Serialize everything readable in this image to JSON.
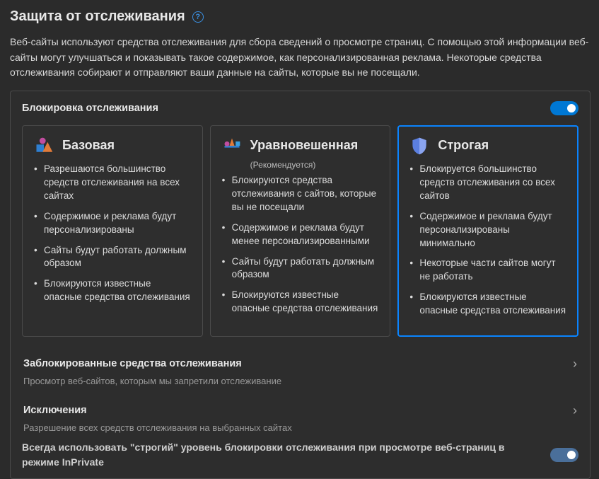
{
  "heading": "Защита от отслеживания",
  "intro": "Веб-сайты используют средства отслеживания для сбора сведений о просмотре страниц. С помощью этой информации веб-сайты могут улучшаться и показывать такое содержимое, как персонализированная реклама. Некоторые средства отслеживания собирают и отправляют ваши данные на сайты, которые вы не посещали.",
  "panel_title": "Блокировка отслеживания",
  "tracking_toggle_on": true,
  "selected_level": "strict",
  "cards": {
    "basic": {
      "title": "Базовая",
      "items": [
        "Разрешаются большинство средств отслеживания на всех сайтах",
        "Содержимое и реклама будут персонализированы",
        "Сайты будут работать должным образом",
        "Блокируются известные опасные средства отслеживания"
      ]
    },
    "balanced": {
      "title": "Уравновешенная",
      "recommended": "(Рекомендуется)",
      "items": [
        "Блокируются средства отслеживания с сайтов, которые вы не посещали",
        "Содержимое и реклама будут менее персонализированными",
        "Сайты будут работать должным образом",
        "Блокируются известные опасные средства отслеживания"
      ]
    },
    "strict": {
      "title": "Строгая",
      "items": [
        "Блокируется большинство средств отслеживания со всех сайтов",
        "Содержимое и реклама будут персонализированы минимально",
        "Некоторые части сайтов могут не работать",
        "Блокируются известные опасные средства отслеживания"
      ]
    }
  },
  "blocked": {
    "title": "Заблокированные средства отслеживания",
    "sub": "Просмотр веб-сайтов, которым мы запретили отслеживание"
  },
  "exceptions": {
    "title": "Исключения",
    "sub": "Разрешение всех средств отслеживания на выбранных сайтах"
  },
  "always_strict": "Всегда использовать \"строгий\" уровень блокировки отслеживания при просмотре веб-страниц в режиме InPrivate",
  "inprivate_toggle_on": true
}
